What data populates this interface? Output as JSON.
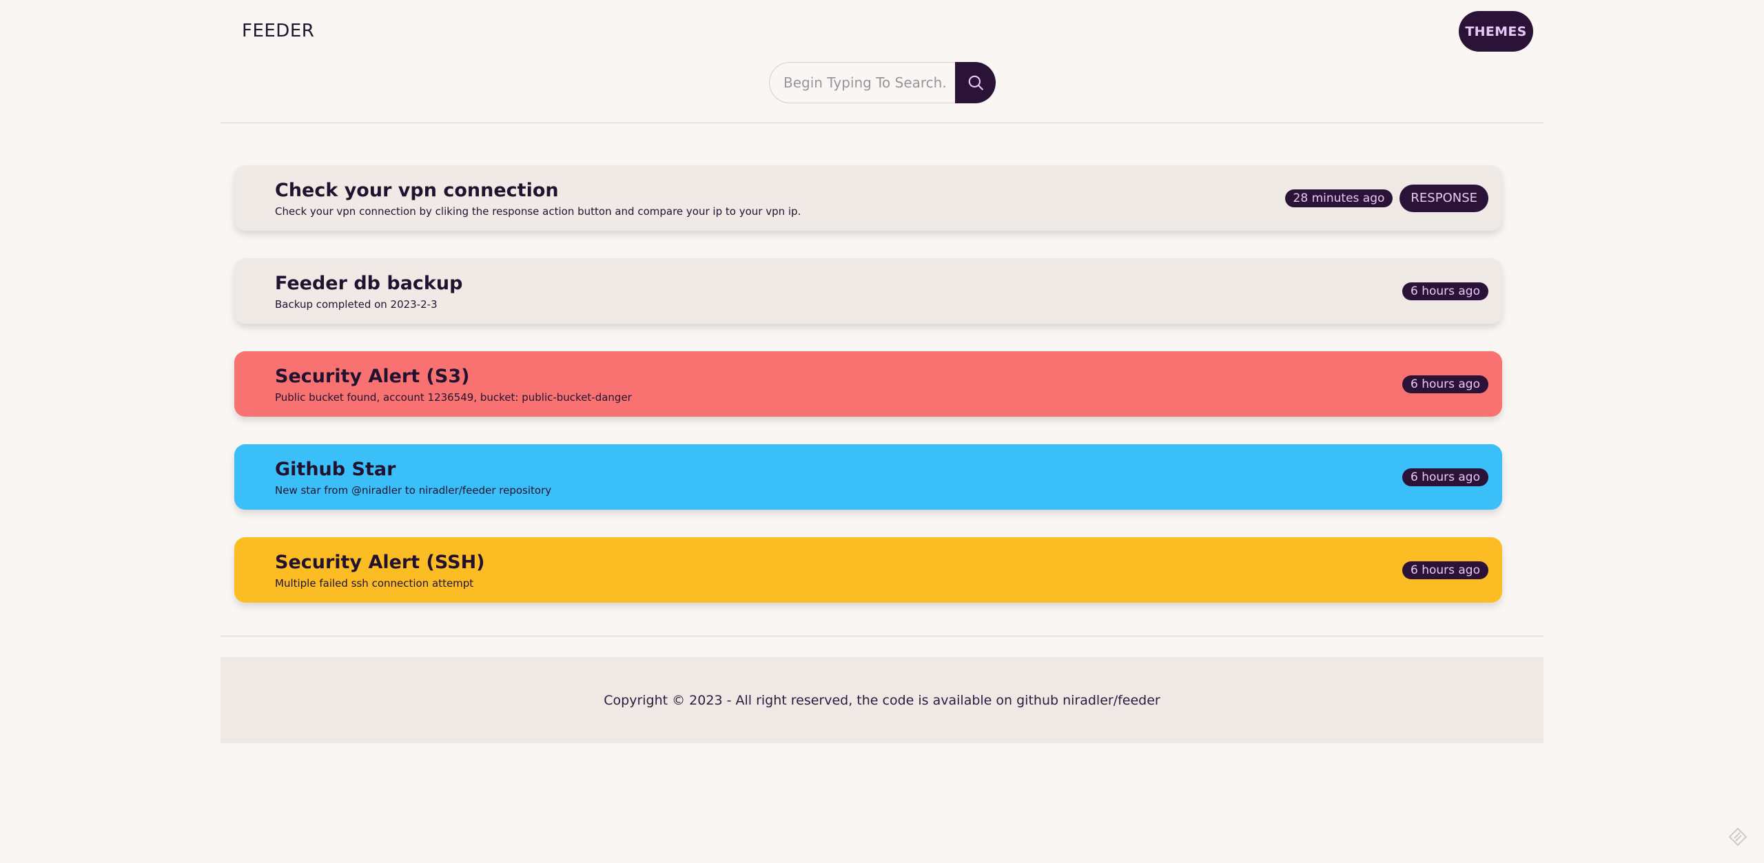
{
  "header": {
    "logo": "FEEDER",
    "themes_label": "THEMES"
  },
  "search": {
    "placeholder": "Begin Typing To Search.",
    "icon": "search-icon"
  },
  "cards": [
    {
      "title": "Check your vpn connection",
      "description": "Check your vpn connection by cliking the response action button and compare your ip to your vpn ip.",
      "time": "28 minutes ago",
      "action": "RESPONSE",
      "color": "#efeae6"
    },
    {
      "title": "Feeder db backup",
      "description": "Backup completed on 2023-2-3",
      "time": "6 hours ago",
      "color": "#efeae6"
    },
    {
      "title": "Security Alert (S3)",
      "description": "Public bucket found, account 1236549, bucket: public-bucket-danger",
      "time": "6 hours ago",
      "color": "#f87272"
    },
    {
      "title": "Github Star",
      "description": "New star from @niradler to niradler/feeder repository",
      "time": "6 hours ago",
      "color": "#3abff8"
    },
    {
      "title": "Security Alert (SSH)",
      "description": "Multiple failed ssh connection attempt",
      "time": "6 hours ago",
      "color": "#fbbd23"
    }
  ],
  "footer": {
    "text": "Copyright © 2023 - All right reserved, the code is available on github niradler/feeder"
  },
  "colors": {
    "accent": "#2b1237",
    "accent_text": "#e8c8f7",
    "background": "#faf6f3"
  }
}
